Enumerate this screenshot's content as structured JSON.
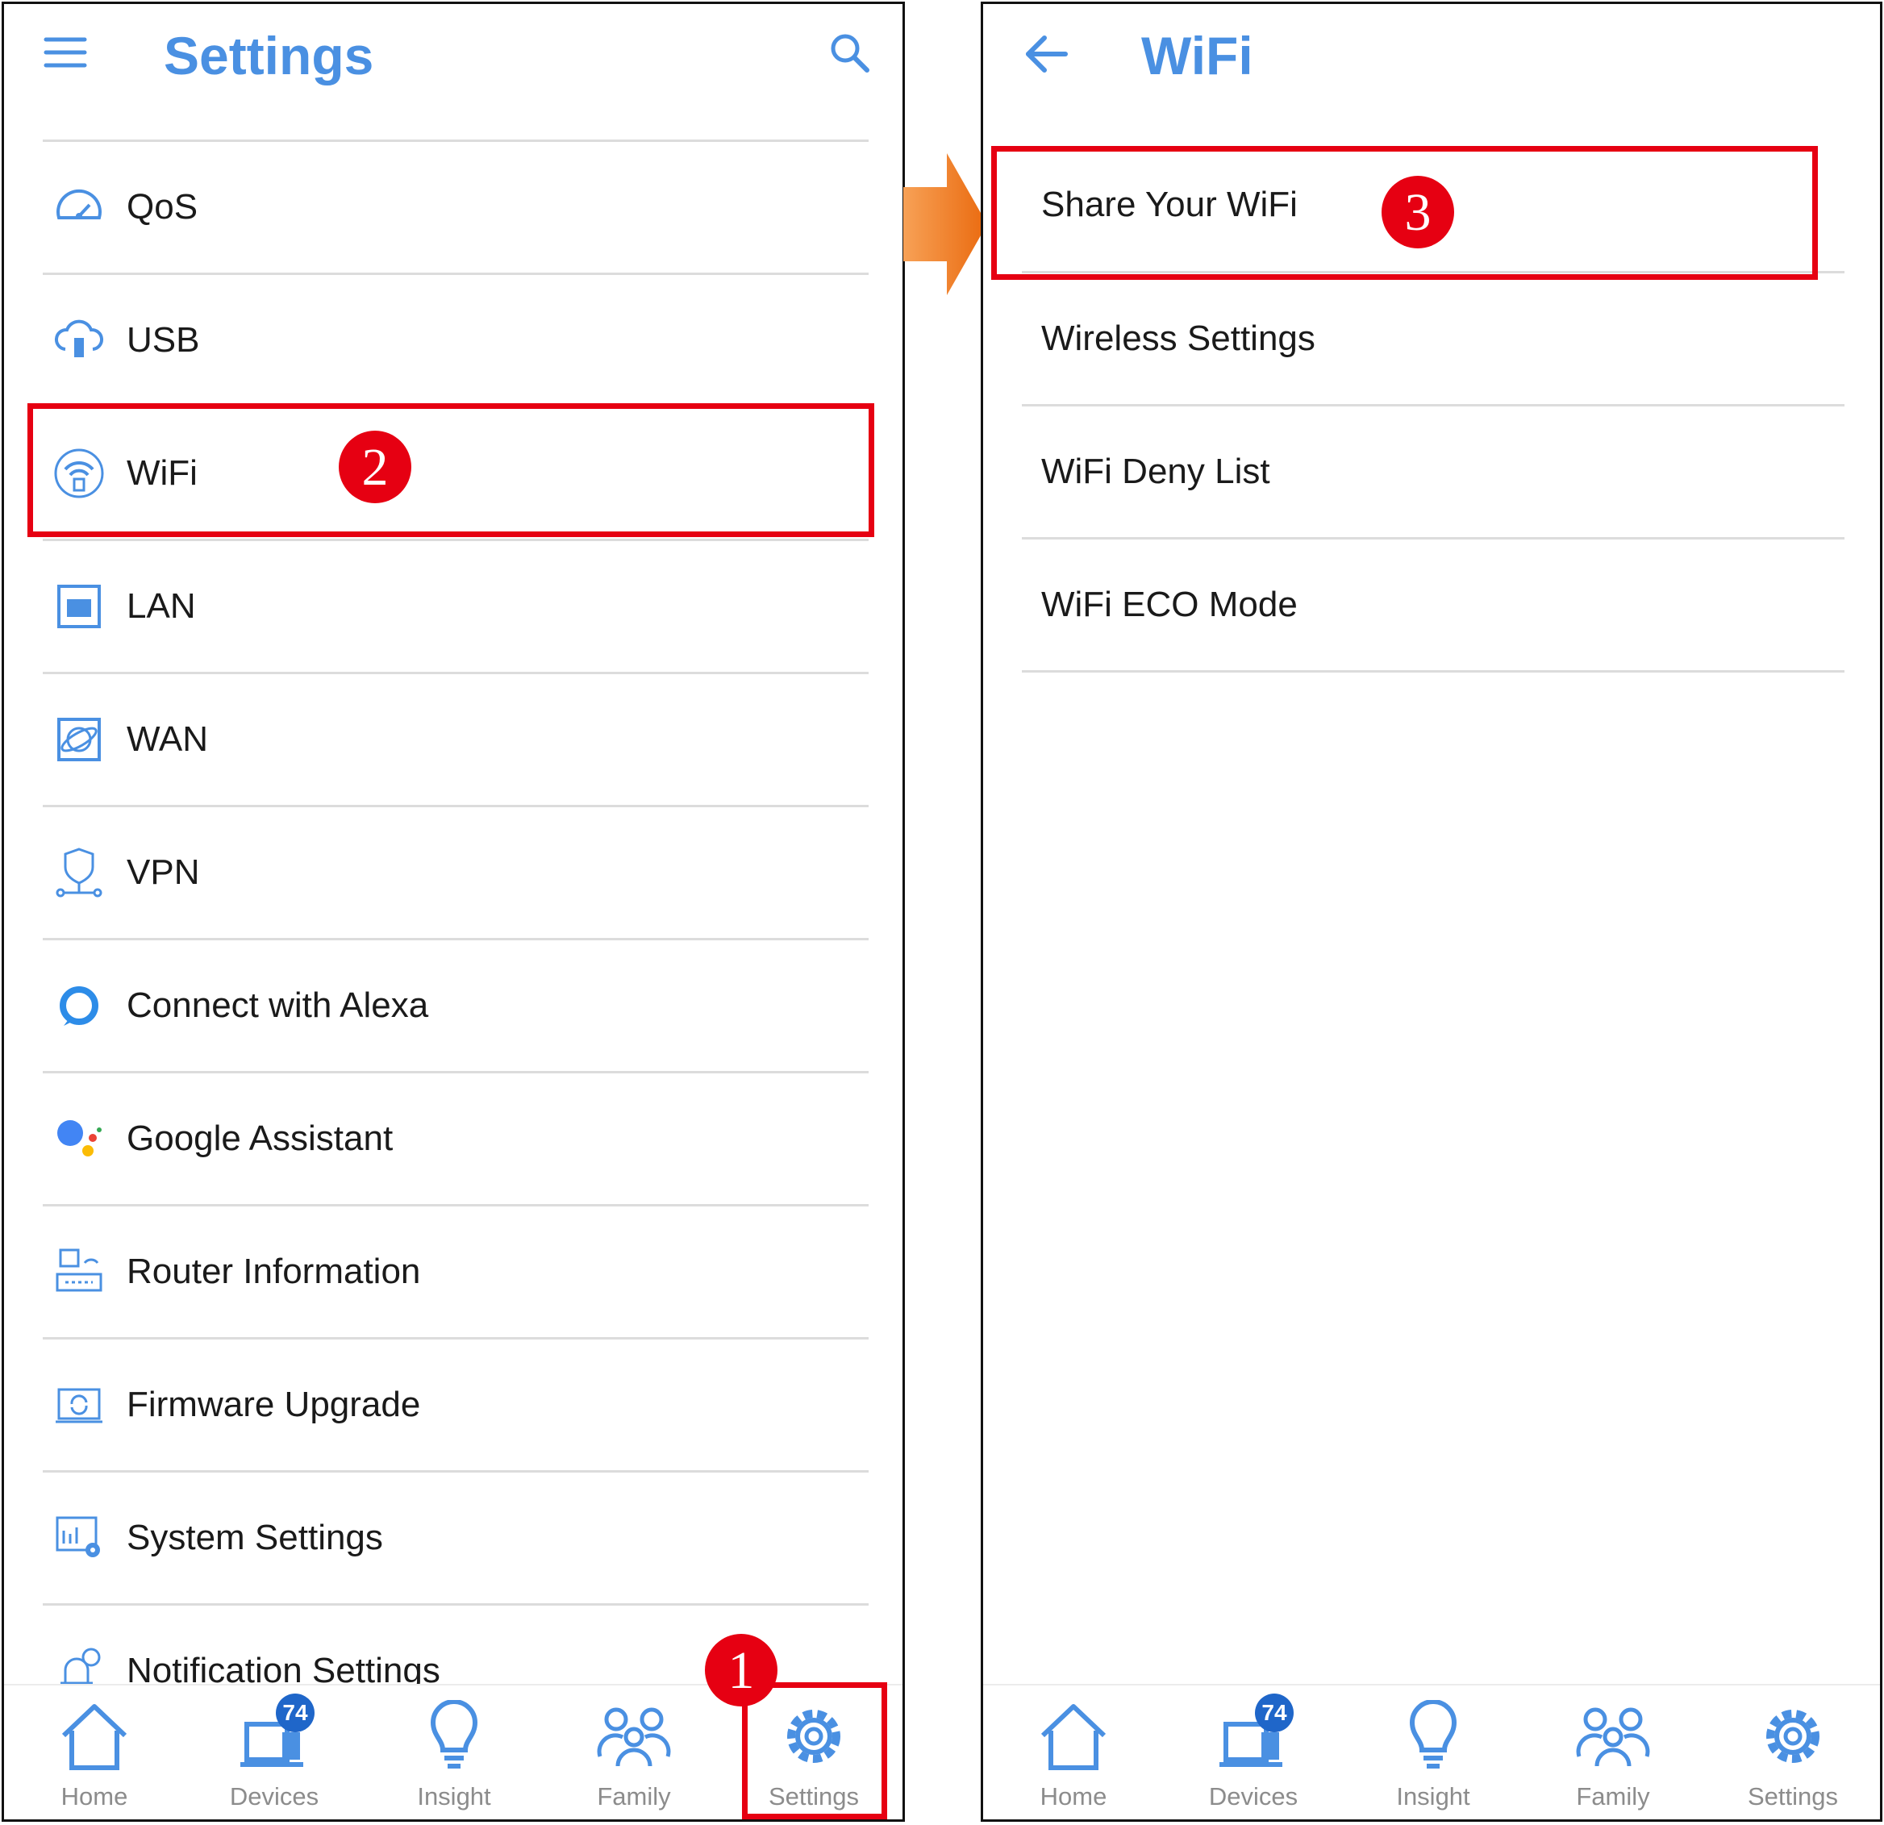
{
  "settings_screen": {
    "title": "Settings",
    "items": [
      {
        "label": "QoS",
        "icon": "speedometer-icon"
      },
      {
        "label": "USB",
        "icon": "usb-cloud-icon"
      },
      {
        "label": "WiFi",
        "icon": "wifi-icon"
      },
      {
        "label": "LAN",
        "icon": "lan-port-icon"
      },
      {
        "label": "WAN",
        "icon": "wan-globe-icon"
      },
      {
        "label": "VPN",
        "icon": "vpn-shield-icon"
      },
      {
        "label": "Connect with Alexa",
        "icon": "alexa-icon"
      },
      {
        "label": "Google Assistant",
        "icon": "google-assistant-icon"
      },
      {
        "label": "Router Information",
        "icon": "router-info-icon"
      },
      {
        "label": "Firmware Upgrade",
        "icon": "firmware-upgrade-icon"
      },
      {
        "label": "System Settings",
        "icon": "system-settings-icon"
      },
      {
        "label": "Notification Settings",
        "icon": "bell-icon"
      }
    ]
  },
  "wifi_screen": {
    "title": "WiFi",
    "items": [
      {
        "label": "Share Your WiFi"
      },
      {
        "label": "Wireless Settings"
      },
      {
        "label": "WiFi Deny List"
      },
      {
        "label": "WiFi ECO Mode"
      }
    ]
  },
  "bottom_nav": {
    "items": [
      {
        "label": "Home",
        "icon": "home-icon"
      },
      {
        "label": "Devices",
        "icon": "devices-icon",
        "badge": "74"
      },
      {
        "label": "Insight",
        "icon": "lightbulb-icon"
      },
      {
        "label": "Family",
        "icon": "family-icon"
      },
      {
        "label": "Settings",
        "icon": "gear-icon"
      }
    ]
  },
  "steps": [
    "1",
    "2",
    "3"
  ],
  "colors": {
    "accent": "#4a90e2",
    "highlight": "#e60012",
    "arrow": "#f08a24",
    "badge": "#1f66c9"
  }
}
